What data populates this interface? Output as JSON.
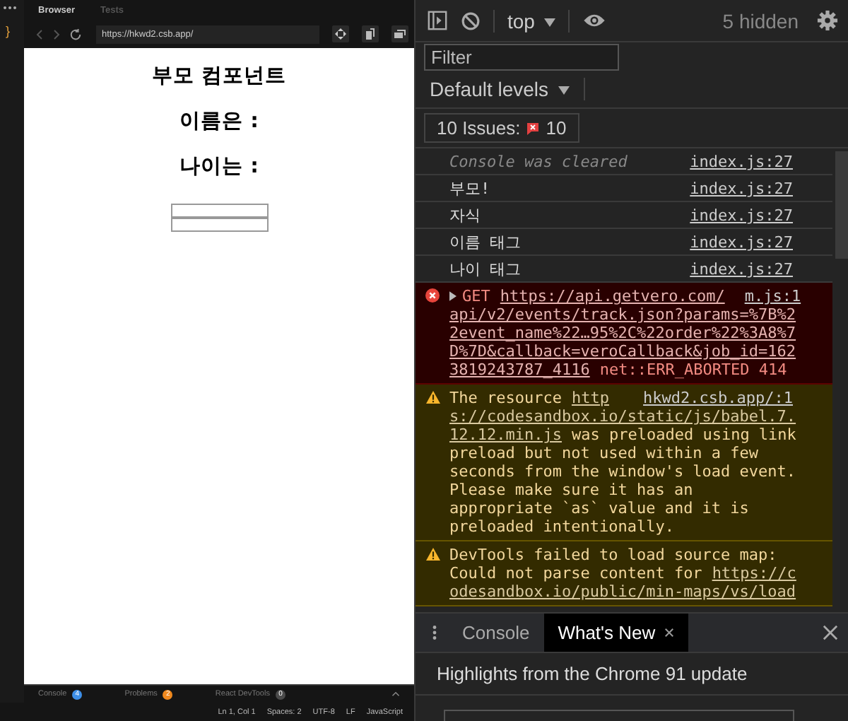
{
  "editor": {
    "code_fragment": "}"
  },
  "browser": {
    "tabs": [
      {
        "label": "Browser",
        "selected": true
      },
      {
        "label": "Tests",
        "selected": false
      }
    ],
    "url": "https://hkwd2.csb.app/",
    "page": {
      "headings": [
        "부모 컴포넌트",
        "이름은 :",
        "나이는 :"
      ],
      "fields": [
        {
          "kind": "text"
        },
        {
          "kind": "text"
        }
      ]
    },
    "panel_tabs": [
      {
        "label": "Console",
        "badge": "4",
        "color": "#3d8fe8"
      },
      {
        "label": "Problems",
        "badge": "2",
        "color": "#f0891e"
      },
      {
        "label": "React DevTools",
        "badge": "0",
        "color": "#4a4a4a"
      }
    ]
  },
  "status_bar": [
    "Ln 1, Col 1",
    "Spaces: 2",
    "UTF-8",
    "LF",
    "JavaScript"
  ],
  "devtools": {
    "context": "top",
    "hidden": "5 hidden",
    "filter_placeholder": "Filter",
    "levels": "Default levels",
    "issues": {
      "label": "10 Issues:",
      "count": "10"
    },
    "messages": [
      {
        "kind": "cleared",
        "source": "index.js:27",
        "lines": [
          [
            {
              "text": "Console was cleared",
              "link": false
            }
          ]
        ]
      },
      {
        "kind": "log",
        "source": "index.js:27",
        "lines": [
          [
            {
              "text": "부모!",
              "link": false
            }
          ]
        ]
      },
      {
        "kind": "log",
        "source": "index.js:27",
        "lines": [
          [
            {
              "text": "자식",
              "link": false
            }
          ]
        ]
      },
      {
        "kind": "log",
        "source": "index.js:27",
        "lines": [
          [
            {
              "text": "이름 태그",
              "link": false
            }
          ]
        ]
      },
      {
        "kind": "log",
        "source": "index.js:27",
        "lines": [
          [
            {
              "text": "나이 태그",
              "link": false
            }
          ]
        ]
      },
      {
        "kind": "error",
        "source": "m.js:1",
        "lines": [
          [
            {
              "text": "GET",
              "link": false
            },
            {
              "text": "https://api.getvero.com/",
              "link": true
            }
          ],
          [
            {
              "text": "api/v2/events/track.json?params=%7B%2",
              "link": true
            }
          ],
          [
            {
              "text": "2event_name%22…95%2C%22order%22%3A8%7",
              "link": true
            }
          ],
          [
            {
              "text": "D%7D&callback=veroCallback&job_id=162",
              "link": true
            }
          ],
          [
            {
              "text": "3819243787_4116",
              "link": true
            },
            {
              "text": "net::ERR_ABORTED 414",
              "link": false
            }
          ]
        ]
      },
      {
        "kind": "warning",
        "source": "hkwd2.csb.app/:1",
        "lines": [
          [
            {
              "text": "The resource",
              "link": false
            },
            {
              "text": "http",
              "link": true
            }
          ],
          [
            {
              "text": "s://codesandbox.io/static/js/babel.7.",
              "link": true
            }
          ],
          [
            {
              "text": "12.12.min.js",
              "link": true
            },
            {
              "text": "was preloaded using link",
              "link": false
            }
          ],
          [
            {
              "text": "preload but not used within a few",
              "link": false
            }
          ],
          [
            {
              "text": "seconds from the window's load event.",
              "link": false
            }
          ],
          [
            {
              "text": "Please make sure it has an",
              "link": false
            }
          ],
          [
            {
              "text": "appropriate `as` value and it is",
              "link": false
            }
          ],
          [
            {
              "text": "preloaded intentionally.",
              "link": false
            }
          ]
        ]
      },
      {
        "kind": "warning",
        "lines": [
          [
            {
              "text": "DevTools failed to load source map:",
              "link": false
            }
          ],
          [
            {
              "text": "Could not parse content for",
              "link": false
            },
            {
              "text": "https://c",
              "link": true
            }
          ],
          [
            {
              "text": "odesandbox.io/public/min-maps/vs/load",
              "link": true
            }
          ]
        ]
      }
    ],
    "drawer": {
      "tabs": [
        {
          "label": "Console",
          "selected": false,
          "closable": false
        },
        {
          "label": "What's New",
          "selected": true,
          "closable": true
        }
      ],
      "headline": "Highlights from the Chrome 91 update"
    }
  }
}
